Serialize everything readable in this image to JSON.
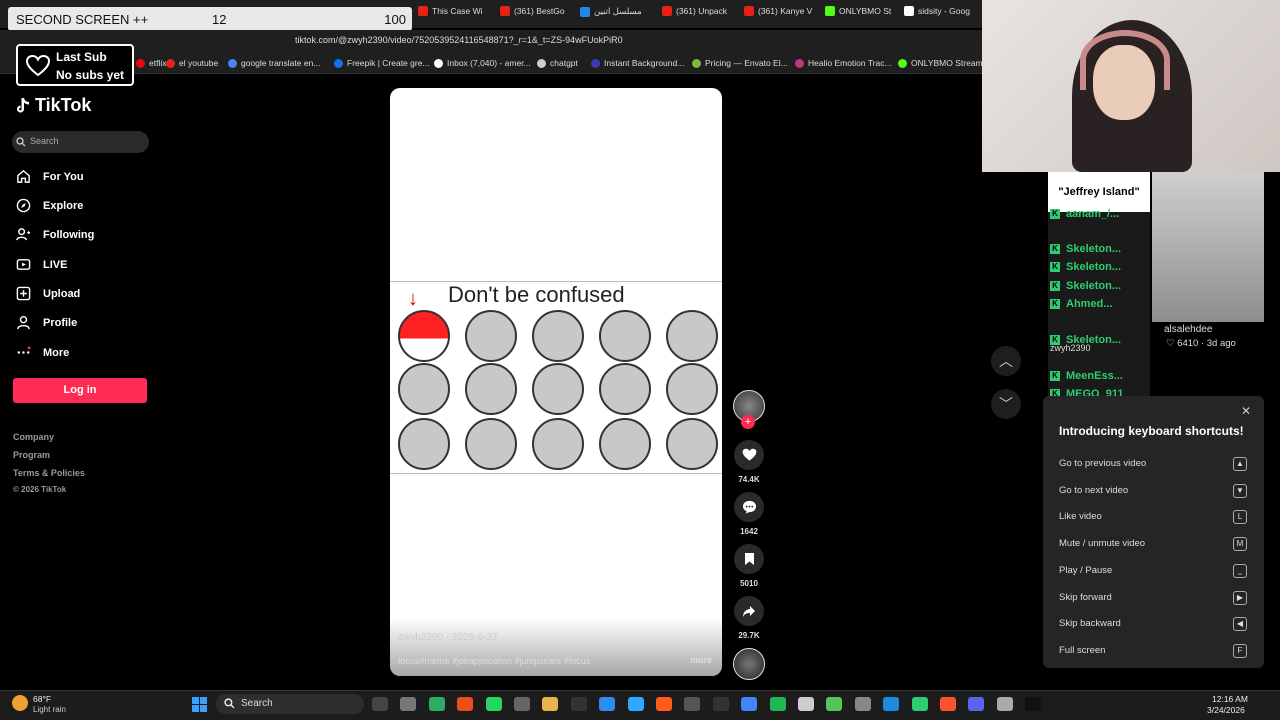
{
  "overlay": {
    "title": "SECOND SCREEN ++",
    "value1": "12",
    "value2": "100"
  },
  "tabs": [
    {
      "label": "This Case Wi",
      "color": "#e62117"
    },
    {
      "label": "(361) BestGo",
      "color": "#e62117"
    },
    {
      "label": "مسلسل اتنين",
      "color": "#1e88e5"
    },
    {
      "label": "(361) Unpack",
      "color": "#e62117"
    },
    {
      "label": "(361) Kanye V",
      "color": "#e62117"
    },
    {
      "label": "ONLYBMO St",
      "color": "#53fc18"
    },
    {
      "label": "sidsity - Goog",
      "color": "#ffffff"
    }
  ],
  "address": {
    "url": "tiktok.com/@zwyh2390/video/7520539524116548871?_r=1&_t=ZS-94wFUokPiR0"
  },
  "bookmarks": [
    {
      "label": "etflix",
      "color": "#e50914"
    },
    {
      "label": "el youtube",
      "color": "#e62117"
    },
    {
      "label": "google translate en...",
      "color": "#4285f4"
    },
    {
      "label": "Freepik | Create gre...",
      "color": "#1273eb"
    },
    {
      "label": "Inbox (7,040) - amer...",
      "color": "#ffffff"
    },
    {
      "label": "chatgpt",
      "color": "#cccccc"
    },
    {
      "label": "Instant Background...",
      "color": "#3b3bb3"
    },
    {
      "label": "Pricing — Envato El...",
      "color": "#82b541"
    },
    {
      "label": "Healio Emotion Trac...",
      "color": "#c13584"
    },
    {
      "label": "ONLYBMO Stream -...",
      "color": "#53fc18"
    }
  ],
  "lastsub": {
    "line1": "Last Sub",
    "line2": "No subs yet"
  },
  "tiktok": {
    "logo": "TikTok",
    "search_placeholder": "Search",
    "nav": [
      {
        "label": "For You",
        "icon": "home-icon"
      },
      {
        "label": "Explore",
        "icon": "compass-icon"
      },
      {
        "label": "Following",
        "icon": "following-icon"
      },
      {
        "label": "LIVE",
        "icon": "live-icon"
      },
      {
        "label": "Upload",
        "icon": "upload-icon"
      },
      {
        "label": "Profile",
        "icon": "profile-icon"
      },
      {
        "label": "More",
        "icon": "more-icon"
      }
    ],
    "login": "Log in",
    "footer": [
      "Company",
      "Program",
      "Terms & Policies",
      "© 2026 TikTok"
    ]
  },
  "video": {
    "title": "Don't be confused",
    "username": "zwyh2390 · 2025-6-27",
    "caption": "focus#meme #jobapplication #jumpscare #focus",
    "more": "more"
  },
  "actions": {
    "likes": "74.4K",
    "comments": "1642",
    "saves": "5010",
    "shares": "29.7K"
  },
  "stream_overlay": {
    "thumb_title": "\"Jeffrey Island\"",
    "chat": [
      {
        "user": "aanam_/..."
      },
      {
        "user": "Skeleton..."
      },
      {
        "user": "Skeleton..."
      },
      {
        "user": "Skeleton..."
      },
      {
        "user": "Ahmed..."
      },
      {
        "user": "Skeleton..."
      },
      {
        "user": "MeenEss..."
      },
      {
        "user": "MEGO_911"
      }
    ],
    "side_user": "alsalehdee",
    "side_likes": "6410 · 3d ago",
    "author": "zwyh2390"
  },
  "shortcuts": {
    "title": "Introducing keyboard shortcuts!",
    "rows": [
      {
        "label": "Go to previous video",
        "key": "▲"
      },
      {
        "label": "Go to next video",
        "key": "▼"
      },
      {
        "label": "Like video",
        "key": "L"
      },
      {
        "label": "Mute / unmute video",
        "key": "M"
      },
      {
        "label": "Play / Pause",
        "key": "⎵"
      },
      {
        "label": "Skip forward",
        "key": "▶"
      },
      {
        "label": "Skip backward",
        "key": "◀"
      },
      {
        "label": "Full screen",
        "key": "F"
      }
    ]
  },
  "taskbar": {
    "temp": "68°F",
    "weather": "Light rain",
    "search": "Search",
    "time": "12:16 AM",
    "date": "3/24/2026",
    "apps": [
      "#444",
      "#777",
      "#27ae60",
      "#e94e1b",
      "#25d366",
      "#666",
      "#e6b64a",
      "#333",
      "#2d8cf0",
      "#31a8ff",
      "#ff5b1a",
      "#555",
      "#333",
      "#4285f4",
      "#1db954",
      "#ccc",
      "#5ac35a",
      "#888",
      "#1b8be0",
      "#2ecc71",
      "#fb542b",
      "#5865f2",
      "#aaa",
      "#111"
    ]
  }
}
